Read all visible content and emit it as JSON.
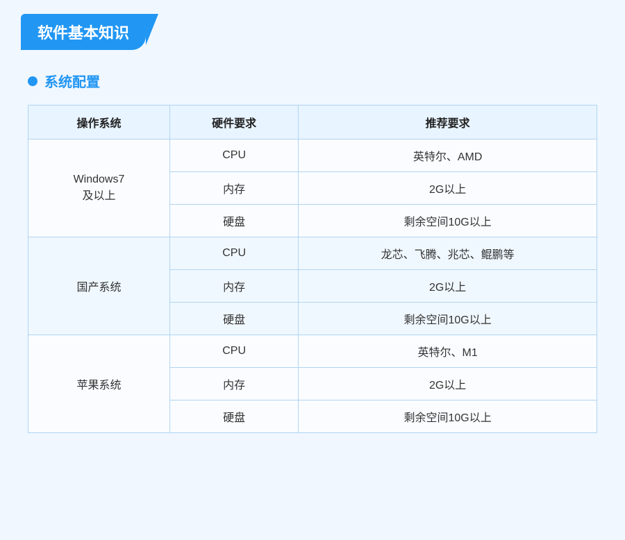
{
  "title": "软件基本知识",
  "section": {
    "label": "系统配置"
  },
  "table": {
    "headers": [
      "操作系统",
      "硬件要求",
      "推荐要求"
    ],
    "rows": [
      {
        "os": "Windows7\n及以上",
        "items": [
          {
            "hw": "CPU",
            "rec": "英特尔、AMD"
          },
          {
            "hw": "内存",
            "rec": "2G以上"
          },
          {
            "hw": "硬盘",
            "rec": "剩余空间10G以上"
          }
        ]
      },
      {
        "os": "国产系统",
        "items": [
          {
            "hw": "CPU",
            "rec": "龙芯、飞腾、兆芯、鲲鹏等"
          },
          {
            "hw": "内存",
            "rec": "2G以上"
          },
          {
            "hw": "硬盘",
            "rec": "剩余空间10G以上"
          }
        ]
      },
      {
        "os": "苹果系统",
        "items": [
          {
            "hw": "CPU",
            "rec": "英特尔、M1"
          },
          {
            "hw": "内存",
            "rec": "2G以上"
          },
          {
            "hw": "硬盘",
            "rec": "剩余空间10G以上"
          }
        ]
      }
    ]
  }
}
